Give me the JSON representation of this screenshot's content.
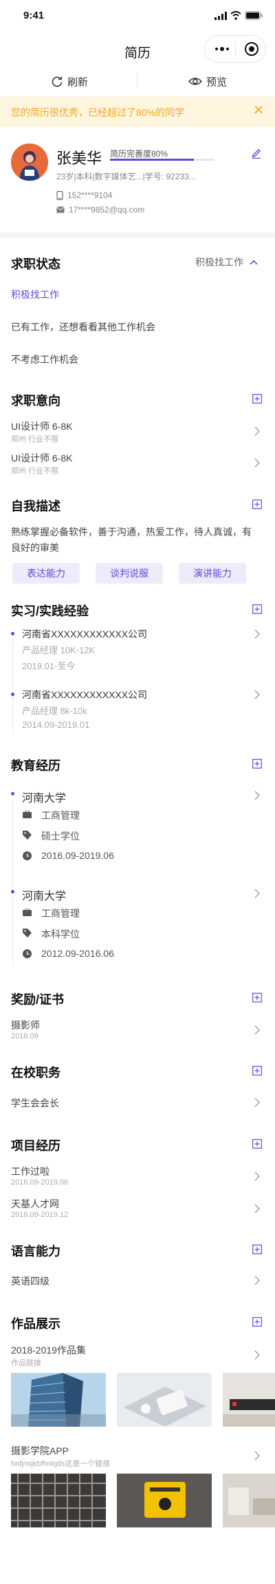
{
  "status_bar": {
    "time": "9:41"
  },
  "nav": {
    "title": "简历"
  },
  "toolbar": {
    "refresh_label": "刷新",
    "preview_label": "预览"
  },
  "banner": {
    "text": "您的简历很优秀，已经超过了80%的同学"
  },
  "profile": {
    "name": "张美华",
    "completion_label": "简历完善度80%",
    "completion_fraction": 0.8,
    "sub_info": "23岁|本科|数字媒体艺...|学号: 92233...",
    "phone": "152****9104",
    "email": "17****9852@qq.com"
  },
  "job_status": {
    "title": "求职状态",
    "current": "积极找工作",
    "options": [
      "积极找工作",
      "已有工作，还想看看其他工作机会",
      "不考虑工作机会"
    ]
  },
  "job_intention": {
    "title": "求职意向",
    "items": [
      {
        "title": "UI设计师 6-8K",
        "sub": "郑州 行业不限"
      },
      {
        "title": "UI设计师 6-8K",
        "sub": "郑州 行业不限"
      }
    ]
  },
  "self_description": {
    "title": "自我描述",
    "text": "熟练掌握必备软件，善于沟通，热爱工作，待人真诚，有良好的审美",
    "tags": [
      "表达能力",
      "谈判说服",
      "演讲能力"
    ]
  },
  "internship": {
    "title": "实习/实践经验",
    "items": [
      {
        "company": "河南省XXXXXXXXXXXX公司",
        "position": "产品经理 10K-12K",
        "period": "2019.01-至今"
      },
      {
        "company": "河南省XXXXXXXXXXXX公司",
        "position": "产品经理 8k-10k",
        "period": "2014.09-2019.01"
      }
    ]
  },
  "education": {
    "title": "教育经历",
    "items": [
      {
        "school": "河南大学",
        "major": "工商管理",
        "degree": "硕士学位",
        "period": "2016.09-2019.06"
      },
      {
        "school": "河南大学",
        "major": "工商管理",
        "degree": "本科学位",
        "period": "2012.09-2016.06"
      }
    ]
  },
  "awards": {
    "title": "奖励/证书",
    "items": [
      {
        "name": "摄影师",
        "date": "2016.09"
      }
    ]
  },
  "campus": {
    "title": "在校职务",
    "items": [
      {
        "name": "学生会会长"
      }
    ]
  },
  "projects": {
    "title": "项目经历",
    "items": [
      {
        "name": "工作过啦",
        "period": "2016.09-2019.06"
      },
      {
        "name": "天基人才网",
        "period": "2016.09-2019.12"
      }
    ]
  },
  "language": {
    "title": "语言能力",
    "items": [
      {
        "name": "英语四级"
      }
    ]
  },
  "portfolio": {
    "title": "作品展示",
    "items": [
      {
        "name": "2018-2019作品集",
        "sub": "作品链接"
      },
      {
        "name": "摄影学院APP",
        "sub": "hnfjnsjkbfhnkjds这是一个链接"
      }
    ]
  },
  "colors": {
    "accent": "#5b4bdb",
    "banner_bg": "#fff6e0",
    "banner_text": "#f5a623"
  }
}
